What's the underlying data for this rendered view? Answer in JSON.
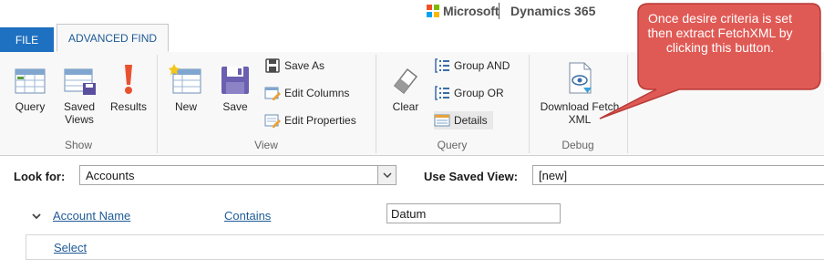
{
  "brand": {
    "company": "Microsoft",
    "product": "Dynamics 365"
  },
  "tabs": {
    "file": "FILE",
    "advanced_find": "ADVANCED FIND"
  },
  "ribbon": {
    "show": {
      "label": "Show",
      "query": "Query",
      "saved_views": "Saved Views",
      "results": "Results"
    },
    "view": {
      "label": "View",
      "new": "New",
      "save": "Save",
      "save_as": "Save As",
      "edit_columns": "Edit Columns",
      "edit_properties": "Edit Properties"
    },
    "query": {
      "label": "Query",
      "clear": "Clear",
      "group_and": "Group AND",
      "group_or": "Group OR",
      "details": "Details"
    },
    "debug": {
      "label": "Debug",
      "download_fetch": "Download Fetch XML"
    }
  },
  "lookfor": {
    "label": "Look for:",
    "value": "Accounts"
  },
  "saved_view": {
    "label": "Use Saved View:",
    "value": "[new]"
  },
  "criteria": {
    "field": "Account Name",
    "operator": "Contains",
    "value": "Datum"
  },
  "select_link": "Select",
  "callout": {
    "text": "Once desire criteria is set then extract FetchXML by clicking this button."
  },
  "colors": {
    "file_tab": "#1e70c0",
    "link": "#1e5a96",
    "callout_fill": "#e05a55",
    "callout_border": "#b83a36"
  }
}
